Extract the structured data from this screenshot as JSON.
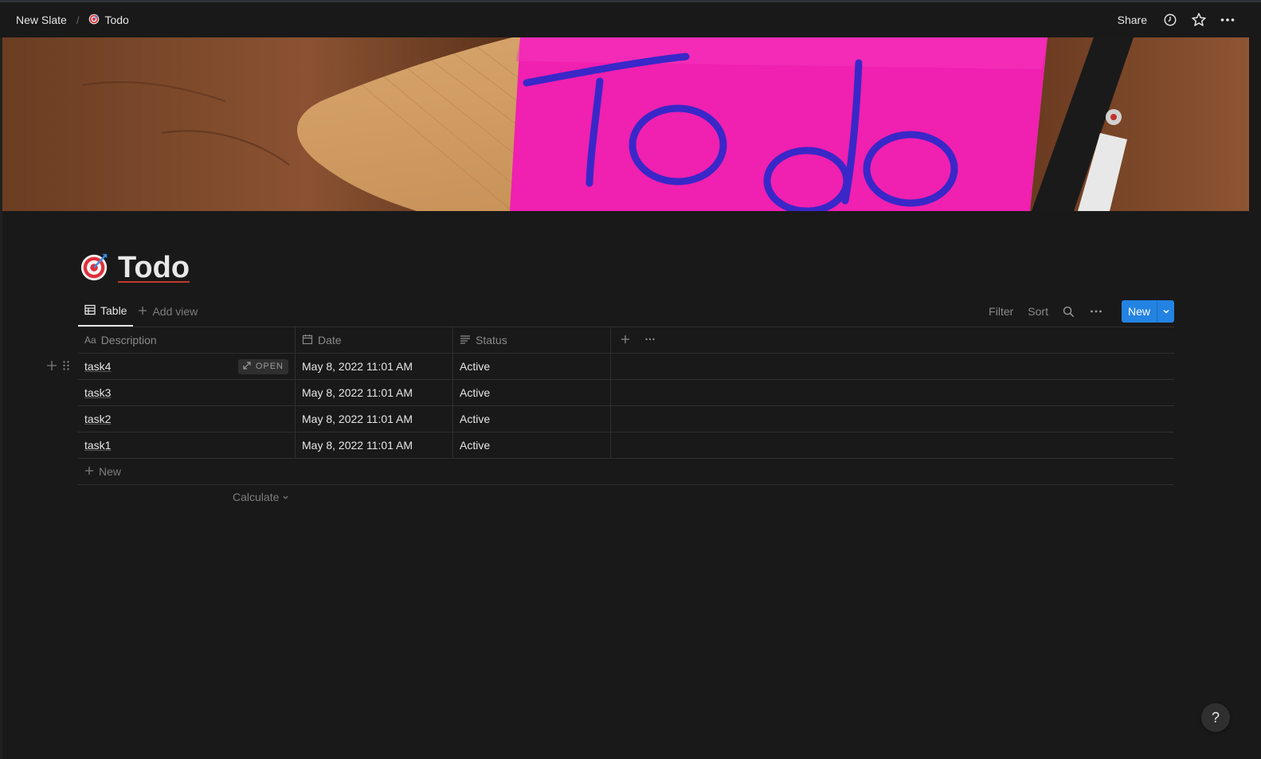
{
  "breadcrumb": [
    {
      "label": "New Slate",
      "icon": ""
    },
    {
      "label": "Todo",
      "icon": "target-icon"
    }
  ],
  "breadcrumb_separator": "/",
  "topbar": {
    "share_label": "Share",
    "icons": [
      "clock-icon",
      "star-icon",
      "more-icon"
    ]
  },
  "cover": {
    "text": "To do",
    "note_color": "#f020b0",
    "ink_color": "#3a27c8"
  },
  "page": {
    "title": "Todo",
    "icon": "target-icon"
  },
  "views": {
    "active_tab": "Table",
    "add_view_label": "Add view",
    "actions": {
      "filter": "Filter",
      "sort": "Sort",
      "new": "New"
    }
  },
  "table": {
    "columns": [
      {
        "label": "Description",
        "icon": "text-aa-icon"
      },
      {
        "label": "Date",
        "icon": "calendar-icon"
      },
      {
        "label": "Status",
        "icon": "lines-icon"
      }
    ],
    "open_label": "OPEN",
    "rows": [
      {
        "description": "task4",
        "date": "May 8, 2022 11:01 AM",
        "status": "Active"
      },
      {
        "description": "task3",
        "date": "May 8, 2022 11:01 AM",
        "status": "Active"
      },
      {
        "description": "task2",
        "date": "May 8, 2022 11:01 AM",
        "status": "Active"
      },
      {
        "description": "task1",
        "date": "May 8, 2022 11:01 AM",
        "status": "Active"
      }
    ],
    "new_row_label": "New",
    "calculate_label": "Calculate"
  },
  "help_label": "?",
  "colors": {
    "background": "#191919",
    "accent": "#2383e2",
    "border": "#2f2f2f"
  }
}
